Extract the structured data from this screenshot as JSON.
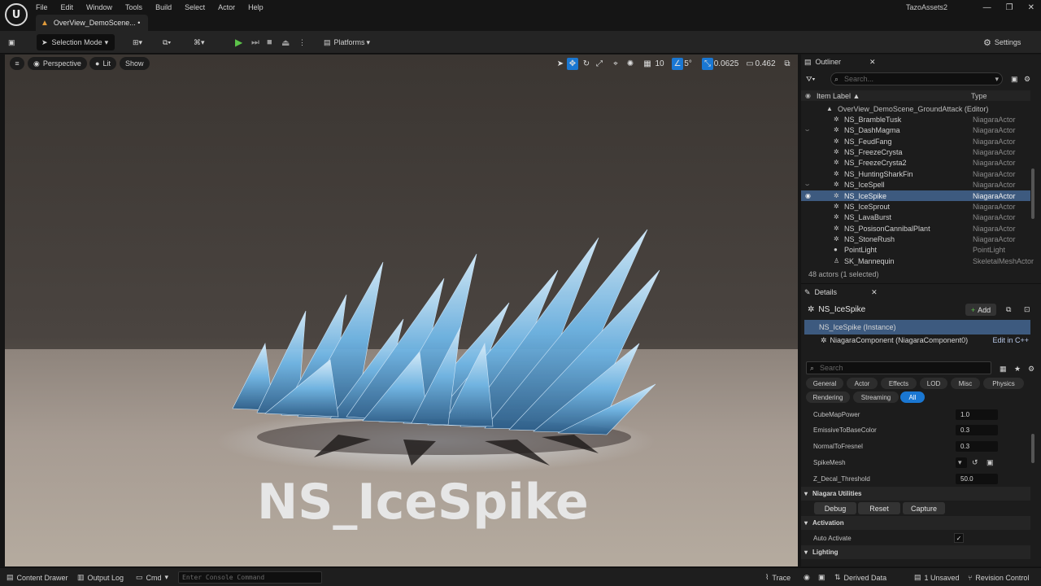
{
  "menus": [
    "File",
    "Edit",
    "Window",
    "Tools",
    "Build",
    "Select",
    "Actor",
    "Help"
  ],
  "doc_tab": "OverView_DemoScene... •",
  "project_name": "TazoAssets2",
  "toolbar": {
    "selection_mode": "Selection Mode",
    "platforms": "Platforms",
    "settings": "Settings"
  },
  "viewport": {
    "perspective": "Perspective",
    "lit": "Lit",
    "show": "Show",
    "grid_size": "10",
    "rotation_snap": "5°",
    "scale_snap": "0.0625",
    "camera_speed": "0.462",
    "overlay_title": "NS_IceSpike"
  },
  "outliner": {
    "tab": "Outliner",
    "search_placeholder": "Search...",
    "col_label": "Item Label ▲",
    "col_type": "Type",
    "root": "OverView_DemoScene_GroundAttack (Editor)",
    "rows": [
      {
        "label": "NS_BrambleTusk",
        "type": "NiagaraActor"
      },
      {
        "label": "NS_DashMagma",
        "type": "NiagaraActor"
      },
      {
        "label": "NS_FeudFang",
        "type": "NiagaraActor"
      },
      {
        "label": "NS_FreezeCrysta",
        "type": "NiagaraActor"
      },
      {
        "label": "NS_FreezeCrysta2",
        "type": "NiagaraActor"
      },
      {
        "label": "NS_HuntingSharkFin",
        "type": "NiagaraActor"
      },
      {
        "label": "NS_IceSpell",
        "type": "NiagaraActor"
      },
      {
        "label": "NS_IceSpike",
        "type": "NiagaraActor"
      },
      {
        "label": "NS_IceSprout",
        "type": "NiagaraActor"
      },
      {
        "label": "NS_LavaBurst",
        "type": "NiagaraActor"
      },
      {
        "label": "NS_PosisonCannibalPlant",
        "type": "NiagaraActor"
      },
      {
        "label": "NS_StoneRush",
        "type": "NiagaraActor"
      },
      {
        "label": "PointLight",
        "type": "PointLight"
      },
      {
        "label": "SK_Mannequin",
        "type": "SkeletalMeshActor"
      }
    ],
    "count": "48 actors (1 selected)"
  },
  "details": {
    "tab": "Details",
    "actor_name": "NS_IceSpike",
    "add": "Add",
    "instance": "NS_IceSpike (Instance)",
    "component": "NiagaraComponent (NiagaraComponent0)",
    "edit_cpp": "Edit in C++",
    "search_placeholder": "Search",
    "categories": [
      "General",
      "Actor",
      "Effects",
      "LOD",
      "Misc",
      "Physics",
      "Rendering",
      "Streaming",
      "All"
    ],
    "props": [
      {
        "name": "CubeMapPower",
        "value": "1.0"
      },
      {
        "name": "EmissiveToBaseColor",
        "value": "0.3"
      },
      {
        "name": "NormalToFresnel",
        "value": "0.3"
      },
      {
        "name": "SpikeMesh",
        "value": ""
      },
      {
        "name": "Z_Decal_Threshold",
        "value": "50.0"
      }
    ],
    "sec_niagara": "Niagara Utilities",
    "btn_debug": "Debug",
    "btn_reset": "Reset",
    "btn_capture": "Capture",
    "sec_activation": "Activation",
    "auto_activate": "Auto Activate",
    "sec_lighting": "Lighting"
  },
  "status": {
    "content_drawer": "Content Drawer",
    "output_log": "Output Log",
    "cmd": "Cmd",
    "console_placeholder": "Enter Console Command",
    "trace": "Trace",
    "derived_data": "Derived Data",
    "unsaved": "1 Unsaved",
    "revision_control": "Revision Control"
  }
}
